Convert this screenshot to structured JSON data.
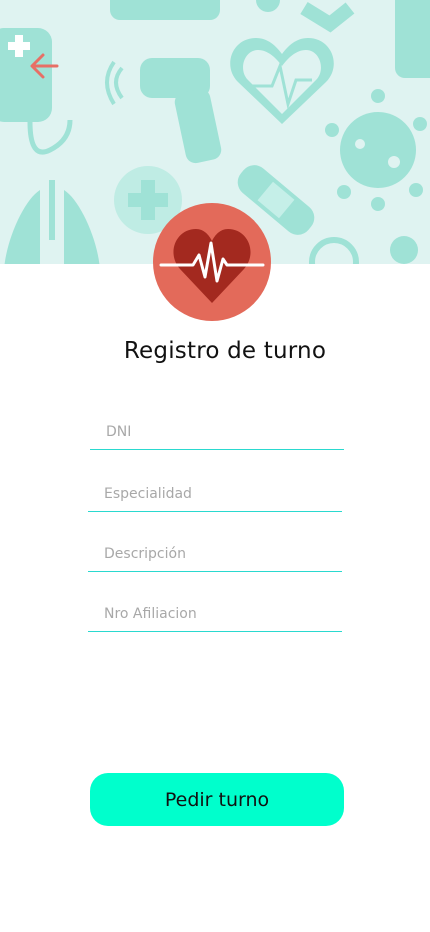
{
  "colors": {
    "hero_background": "#dff3f1",
    "hero_pattern": "#9fe2d6",
    "accent": "#00ffcc",
    "field_underline": "#2ad9cf",
    "logo_circle": "#e36a5a",
    "logo_heart": "#a3291f",
    "back_arrow": "#e76f66"
  },
  "header": {
    "back_icon": "arrow-left-icon",
    "logo_icon": "heart-pulse-icon"
  },
  "title": "Registro de turno",
  "form": {
    "dni": {
      "placeholder": "DNI",
      "value": ""
    },
    "especialidad": {
      "placeholder": "Especialidad",
      "value": ""
    },
    "descripcion": {
      "placeholder": "Descripción",
      "value": ""
    },
    "afiliacion": {
      "placeholder": "Nro Afiliacion",
      "value": ""
    }
  },
  "submit_label": "Pedir turno"
}
